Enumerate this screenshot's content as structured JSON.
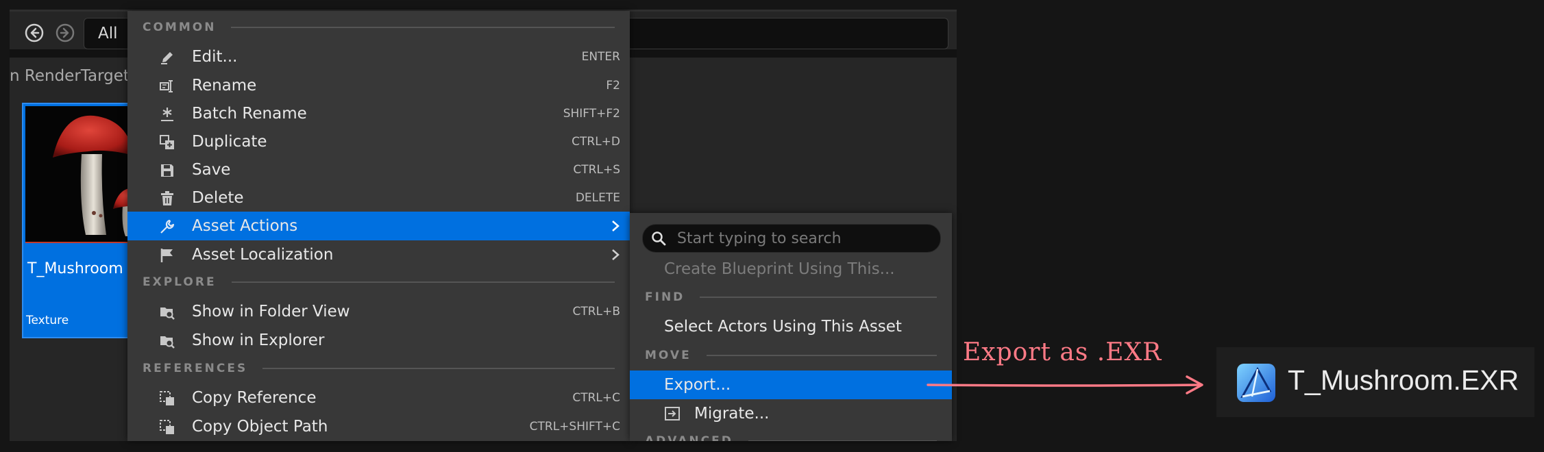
{
  "toolbar": {
    "back_icon": "arrow-left-circle-icon",
    "forward_icon": "arrow-right-circle-icon",
    "filter_label": "All"
  },
  "breadcrumb": "n RenderTargets",
  "asset_tile": {
    "name": "T_Mushroom",
    "type": "Texture"
  },
  "menu": {
    "sections": {
      "common": "COMMON",
      "explore": "EXPLORE",
      "references": "REFERENCES"
    },
    "items": [
      {
        "label": "Edit...",
        "shortcut": "ENTER",
        "icon": "pencil-icon"
      },
      {
        "label": "Rename",
        "shortcut": "F2",
        "icon": "rename-icon"
      },
      {
        "label": "Batch Rename",
        "shortcut": "SHIFT+F2",
        "icon": "batch-rename-icon"
      },
      {
        "label": "Duplicate",
        "shortcut": "CTRL+D",
        "icon": "duplicate-icon"
      },
      {
        "label": "Save",
        "shortcut": "CTRL+S",
        "icon": "save-icon"
      },
      {
        "label": "Delete",
        "shortcut": "DELETE",
        "icon": "trash-icon"
      },
      {
        "label": "Asset Actions",
        "shortcut": "",
        "icon": "wrench-icon"
      },
      {
        "label": "Asset Localization",
        "shortcut": "",
        "icon": "flag-icon"
      },
      {
        "label": "Show in Folder View",
        "shortcut": "CTRL+B",
        "icon": "folder-search-icon"
      },
      {
        "label": "Show in Explorer",
        "shortcut": "",
        "icon": "folder-search-icon"
      },
      {
        "label": "Copy Reference",
        "shortcut": "CTRL+C",
        "icon": "copy-reference-icon"
      },
      {
        "label": "Copy Object Path",
        "shortcut": "CTRL+SHIFT+C",
        "icon": "copy-path-icon"
      }
    ]
  },
  "submenu": {
    "search_placeholder": "Start typing to search",
    "sections": {
      "find": "FIND",
      "move": "MOVE",
      "advanced": "ADVANCED"
    },
    "items": [
      {
        "label": "Create Blueprint Using This..."
      },
      {
        "label": "Select Actors Using This Asset"
      },
      {
        "label": "Export..."
      },
      {
        "label": "Migrate...",
        "icon": "migrate-icon"
      }
    ]
  },
  "annotation": {
    "text": "Export as .EXR",
    "color": "#ff7a86"
  },
  "result": {
    "filename": "T_Mushroom.EXR",
    "icon": "affinity-photo-icon"
  },
  "colors": {
    "highlight": "#0070e0",
    "menu_bg": "#383838",
    "annotation": "#ff7a86"
  }
}
